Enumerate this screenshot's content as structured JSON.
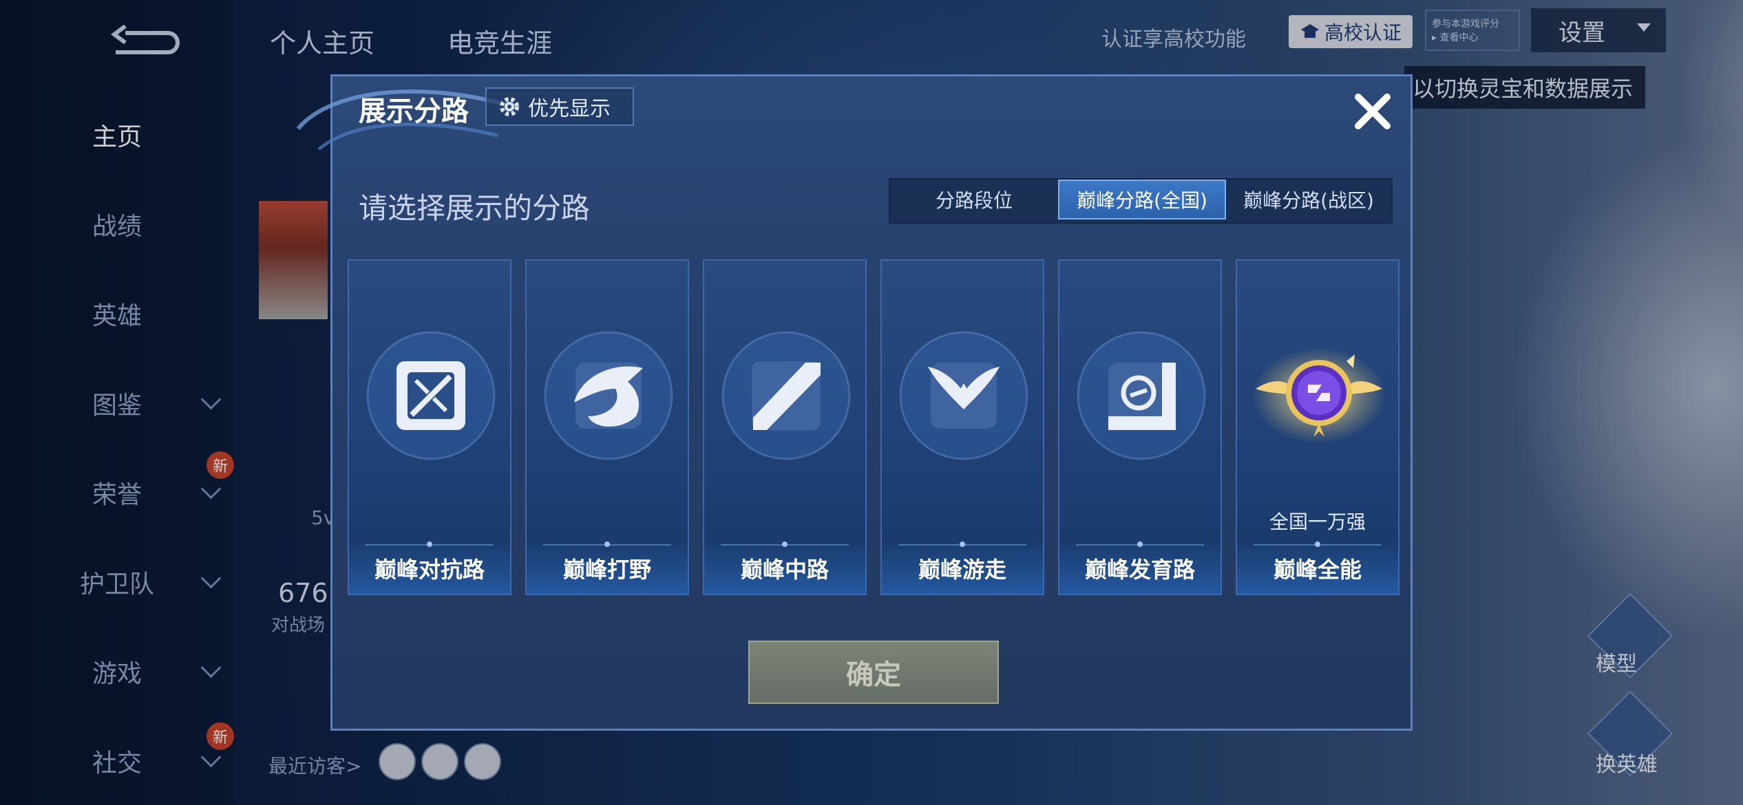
{
  "sidebar": {
    "items": [
      {
        "label": "主页"
      },
      {
        "label": "战绩"
      },
      {
        "label": "英雄"
      },
      {
        "label": "图鉴"
      },
      {
        "label": "荣誉",
        "badge": "新"
      },
      {
        "label": "护卫队"
      },
      {
        "label": "游戏"
      },
      {
        "label": "社交",
        "badge": "新"
      }
    ]
  },
  "top": {
    "tabs": [
      "个人主页",
      "电竞生涯"
    ],
    "auth_text": "认证享高校功能",
    "auth_button": "高校认证",
    "small_box_line1": "参与本游戏评分",
    "small_box_line2": "▸ 查看中心",
    "settings": "设置",
    "tip": "以切换灵宝和数据展示"
  },
  "background": {
    "score": "676",
    "score_label": "对战场",
    "mode_text": "5v",
    "recent_visitors": "最近访客>",
    "right_buttons": [
      "模型",
      "换英雄"
    ]
  },
  "modal": {
    "title": "展示分路",
    "priority_label": "优先显示",
    "subtitle": "请选择展示的分路",
    "segments": [
      "分路段位",
      "巅峰分路(全国)",
      "巅峰分路(战区)"
    ],
    "active_segment": 1,
    "cards": [
      {
        "label": "巅峰对抗路",
        "icon": "clash-lane-icon"
      },
      {
        "label": "巅峰打野",
        "icon": "jungle-dragon-icon"
      },
      {
        "label": "巅峰中路",
        "icon": "mid-lane-icon"
      },
      {
        "label": "巅峰游走",
        "icon": "roam-wings-icon"
      },
      {
        "label": "巅峰发育路",
        "icon": "farm-lane-icon"
      },
      {
        "label": "巅峰全能",
        "icon": "allround-emblem-icon",
        "rank": "全国一万强"
      }
    ],
    "confirm": "确定"
  },
  "colors": {
    "accent": "#3c79c8",
    "modal_bg": "#263f6b",
    "confirm_bg": "#6f776e",
    "gold": "#e8c45a"
  }
}
